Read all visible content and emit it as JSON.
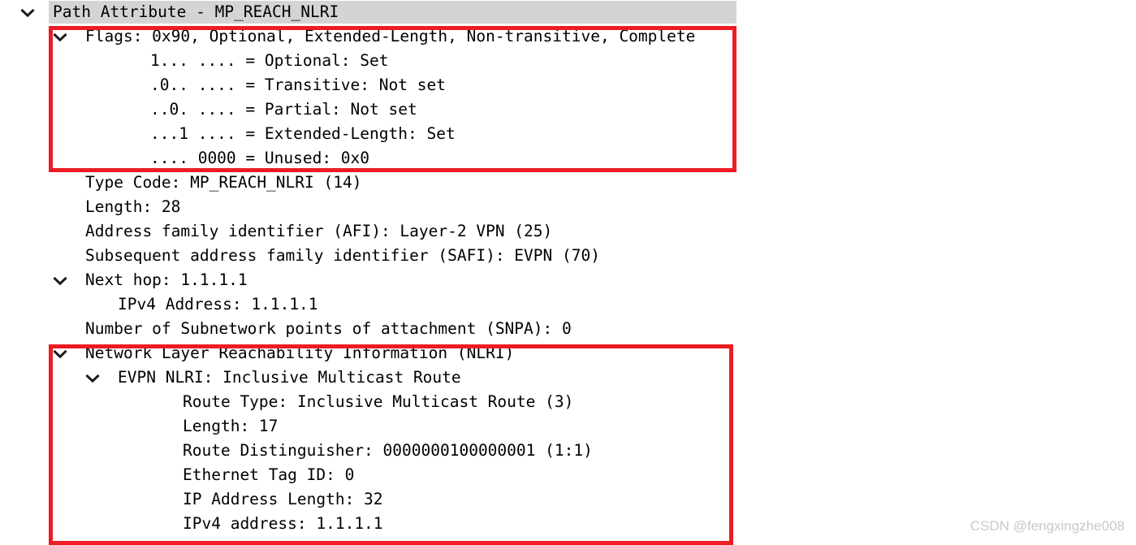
{
  "app": {
    "title": "Wireshark packet detail tree",
    "watermark": "CSDN @fengxingzhe008"
  },
  "colors": {
    "annotation_red": "#ed1c24",
    "selection_gray": "#d4d4d4",
    "text": "#000000",
    "watermark": "#c9c9c9"
  },
  "tree": {
    "rows": [
      {
        "id": "path-attribute",
        "label": "Path Attribute - MP_REACH_NLRI",
        "indent": 0,
        "expander": "chevron-down-icon",
        "selected": true
      },
      {
        "id": "flags",
        "label": "Flags: 0x90, Optional, Extended-Length, Non-transitive, Complete",
        "indent": 1,
        "expander": "chevron-down-icon",
        "selected": false
      },
      {
        "id": "flag-optional",
        "label": "1... .... = Optional: Set",
        "indent": 3,
        "expander": "none",
        "selected": false
      },
      {
        "id": "flag-transitive",
        "label": ".0.. .... = Transitive: Not set",
        "indent": 3,
        "expander": "none",
        "selected": false
      },
      {
        "id": "flag-partial",
        "label": "..0. .... = Partial: Not set",
        "indent": 3,
        "expander": "none",
        "selected": false
      },
      {
        "id": "flag-extended-length",
        "label": "...1 .... = Extended-Length: Set",
        "indent": 3,
        "expander": "none",
        "selected": false
      },
      {
        "id": "flag-unused",
        "label": ".... 0000 = Unused: 0x0",
        "indent": 3,
        "expander": "none",
        "selected": false
      },
      {
        "id": "type-code",
        "label": "Type Code: MP_REACH_NLRI (14)",
        "indent": 1,
        "expander": "none",
        "selected": false
      },
      {
        "id": "length",
        "label": "Length: 28",
        "indent": 1,
        "expander": "none",
        "selected": false
      },
      {
        "id": "afi",
        "label": "Address family identifier (AFI): Layer-2 VPN (25)",
        "indent": 1,
        "expander": "none",
        "selected": false
      },
      {
        "id": "safi",
        "label": "Subsequent address family identifier (SAFI): EVPN (70)",
        "indent": 1,
        "expander": "none",
        "selected": false
      },
      {
        "id": "next-hop",
        "label": "Next hop: 1.1.1.1",
        "indent": 1,
        "expander": "chevron-down-icon",
        "selected": false
      },
      {
        "id": "next-hop-ipv4",
        "label": "IPv4 Address: 1.1.1.1",
        "indent": 2,
        "expander": "none",
        "selected": false
      },
      {
        "id": "snpa",
        "label": "Number of Subnetwork points of attachment (SNPA): 0",
        "indent": 1,
        "expander": "none",
        "selected": false
      },
      {
        "id": "nlri",
        "label": "Network Layer Reachability Information (NLRI)",
        "indent": 1,
        "expander": "chevron-down-icon",
        "selected": false
      },
      {
        "id": "evpn-nlri",
        "label": "EVPN NLRI: Inclusive Multicast Route",
        "indent": 2,
        "expander": "chevron-down-icon",
        "selected": false
      },
      {
        "id": "route-type",
        "label": "Route Type: Inclusive Multicast Route (3)",
        "indent": 4,
        "expander": "none",
        "selected": false
      },
      {
        "id": "nlri-length",
        "label": "Length: 17",
        "indent": 4,
        "expander": "none",
        "selected": false
      },
      {
        "id": "route-distinguisher",
        "label": "Route Distinguisher: 0000000100000001 (1:1)",
        "indent": 4,
        "expander": "none",
        "selected": false
      },
      {
        "id": "ethernet-tag-id",
        "label": "Ethernet Tag ID: 0",
        "indent": 4,
        "expander": "none",
        "selected": false
      },
      {
        "id": "ip-address-length",
        "label": "IP Address Length: 32",
        "indent": 4,
        "expander": "none",
        "selected": false
      },
      {
        "id": "ipv4-address",
        "label": "IPv4 address: 1.1.1.1",
        "indent": 4,
        "expander": "none",
        "selected": false
      }
    ]
  },
  "annotations": [
    {
      "id": "flags-highlight",
      "label": "Flags section highlight box"
    },
    {
      "id": "nlri-highlight",
      "label": "NLRI section highlight box"
    }
  ]
}
